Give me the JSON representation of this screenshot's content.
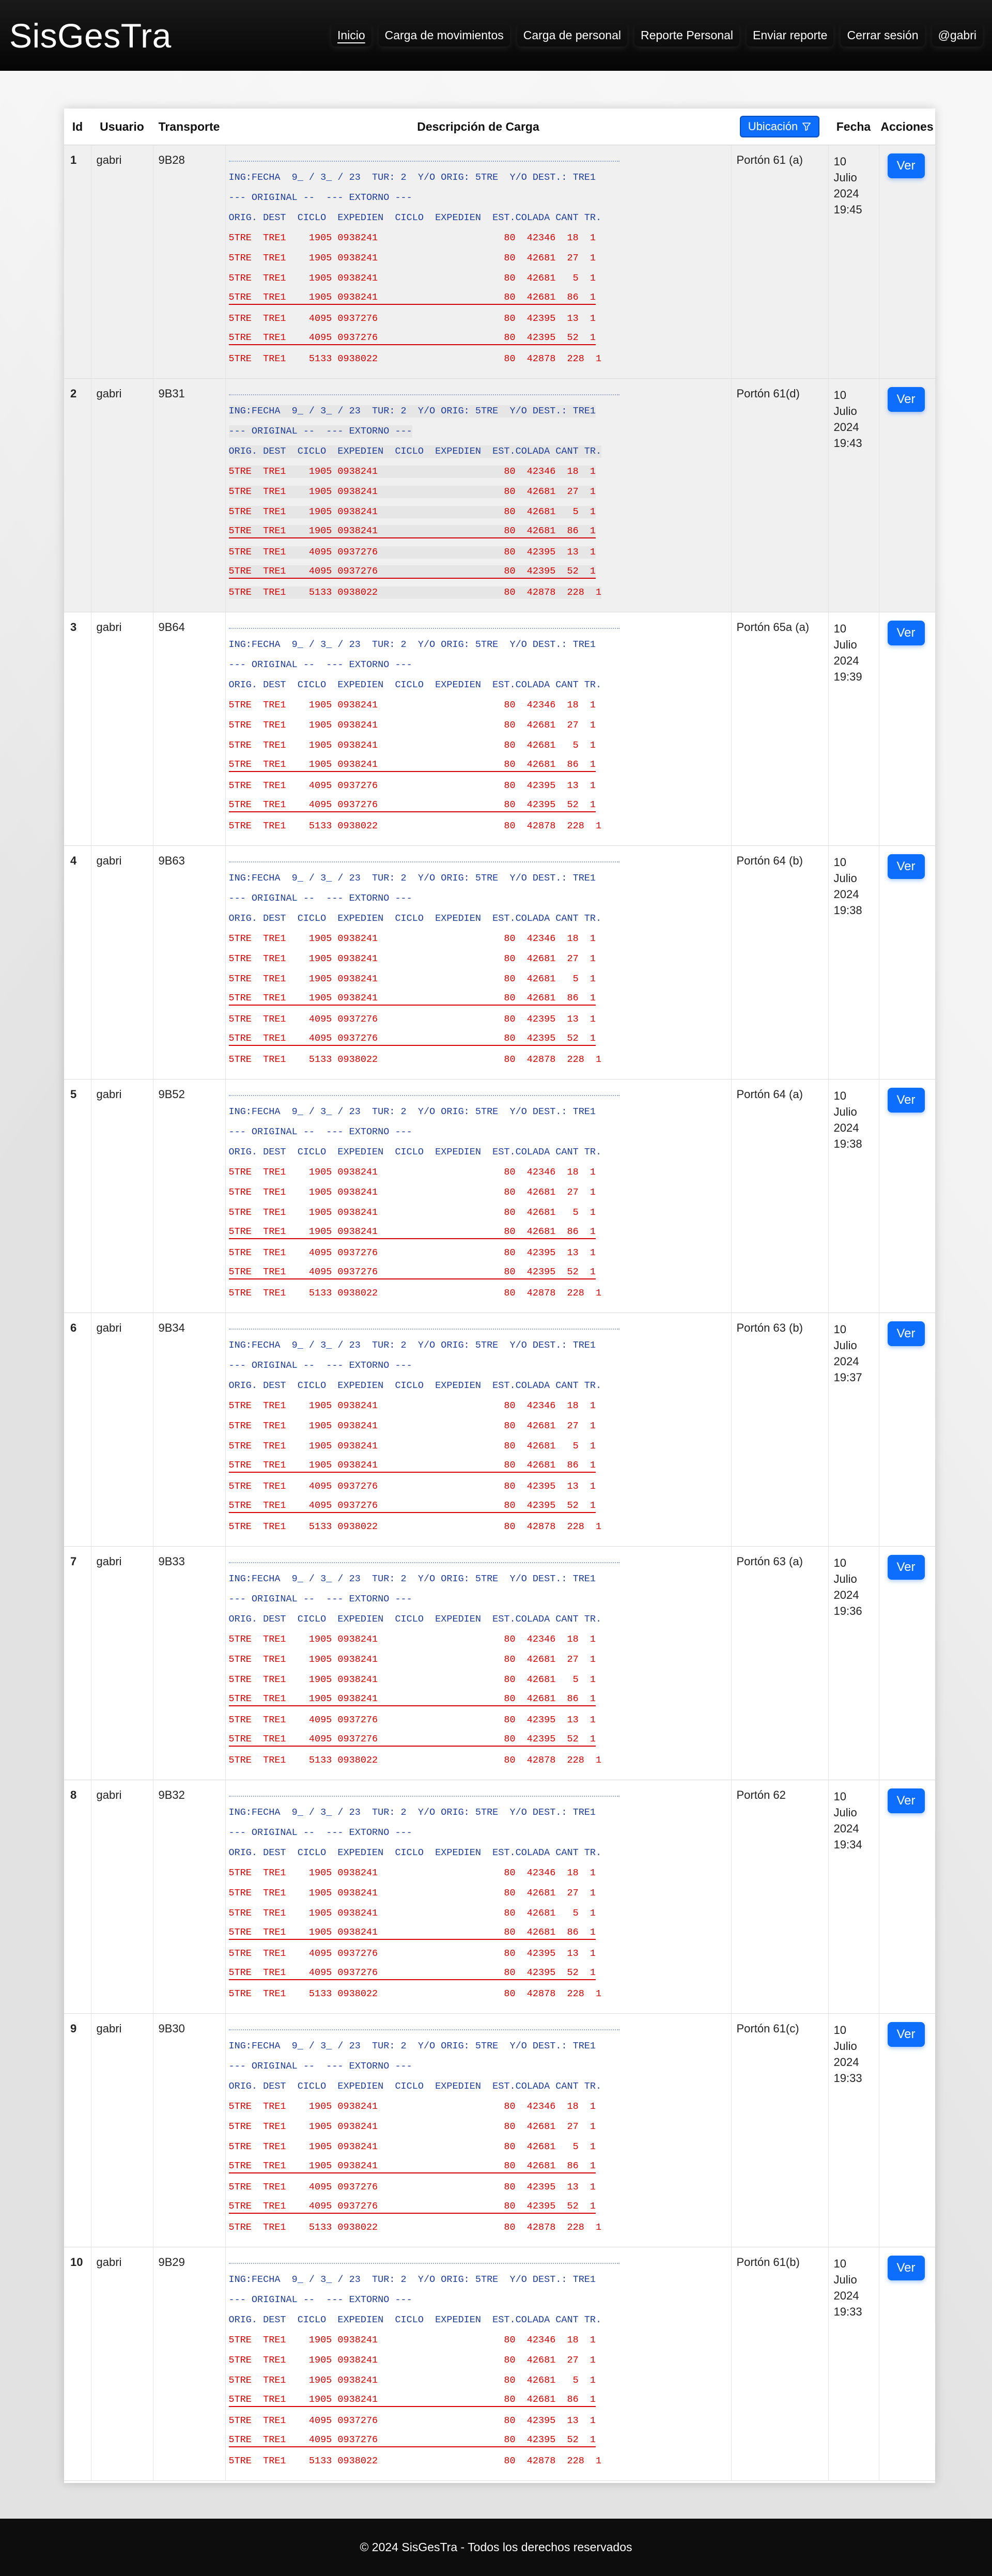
{
  "app": {
    "brand": "SisGesTra"
  },
  "nav": [
    {
      "label": "Inicio"
    },
    {
      "label": "Carga de movimientos"
    },
    {
      "label": "Carga de personal"
    },
    {
      "label": "Reporte Personal"
    },
    {
      "label": "Enviar reporte"
    },
    {
      "label": "Cerrar sesión"
    },
    {
      "label": "@gabri"
    }
  ],
  "table": {
    "headers": {
      "id": "Id",
      "usuario": "Usuario",
      "transporte": "Transporte",
      "descripcion": "Descripción de Carga",
      "ubicacion": "Ubicación",
      "fecha": "Fecha",
      "acciones": "Acciones"
    },
    "filter_icon": "filter-icon",
    "view_label": "Ver"
  },
  "cargo_lines": {
    "l1": "ING:FECHA  9_ / 3_ / 23  TUR: 2  Y/O ORIG: 5TRE  Y/O DEST.: TRE1",
    "l2": "--- ORIGINAL --  --- EXTORNO ---",
    "l3": "ORIG. DEST  CICLO  EXPEDIEN  CICLO  EXPEDIEN  EST.COLADA CANT TR.",
    "r1": "5TRE  TRE1    1905 0938241                      80  42346  18  1",
    "r2": "5TRE  TRE1    1905 0938241                      80  42681  27  1",
    "r3": "5TRE  TRE1    1905 0938241                      80  42681   5  1",
    "r4": "5TRE  TRE1    1905 0938241                      80  42681  86  1",
    "r5": "5TRE  TRE1    4095 0937276                      80  42395  13  1",
    "r6": "5TRE  TRE1    4095 0937276                      80  42395  52  1",
    "r7": "5TRE  TRE1    5133 0938022                      80  42878  228  1"
  },
  "rows": [
    {
      "id": "1",
      "usuario": "gabri",
      "transporte": "9B28",
      "ubicacion": "Portón 61 (a)",
      "dia": "10",
      "mes": "Julio",
      "anio": "2024",
      "hora": "19:45"
    },
    {
      "id": "2",
      "usuario": "gabri",
      "transporte": "9B31",
      "ubicacion": "Portón 61(d)",
      "dia": "10",
      "mes": "Julio",
      "anio": "2024",
      "hora": "19:43"
    },
    {
      "id": "3",
      "usuario": "gabri",
      "transporte": "9B64",
      "ubicacion": "Portón 65a (a)",
      "dia": "10",
      "mes": "Julio",
      "anio": "2024",
      "hora": "19:39"
    },
    {
      "id": "4",
      "usuario": "gabri",
      "transporte": "9B63",
      "ubicacion": "Portón 64 (b)",
      "dia": "10",
      "mes": "Julio",
      "anio": "2024",
      "hora": "19:38"
    },
    {
      "id": "5",
      "usuario": "gabri",
      "transporte": "9B52",
      "ubicacion": "Portón 64 (a)",
      "dia": "10",
      "mes": "Julio",
      "anio": "2024",
      "hora": "19:38"
    },
    {
      "id": "6",
      "usuario": "gabri",
      "transporte": "9B34",
      "ubicacion": "Portón 63 (b)",
      "dia": "10",
      "mes": "Julio",
      "anio": "2024",
      "hora": "19:37"
    },
    {
      "id": "7",
      "usuario": "gabri",
      "transporte": "9B33",
      "ubicacion": "Portón 63 (a)",
      "dia": "10",
      "mes": "Julio",
      "anio": "2024",
      "hora": "19:36"
    },
    {
      "id": "8",
      "usuario": "gabri",
      "transporte": "9B32",
      "ubicacion": "Portón 62",
      "dia": "10",
      "mes": "Julio",
      "anio": "2024",
      "hora": "19:34"
    },
    {
      "id": "9",
      "usuario": "gabri",
      "transporte": "9B30",
      "ubicacion": "Portón 61(c)",
      "dia": "10",
      "mes": "Julio",
      "anio": "2024",
      "hora": "19:33"
    },
    {
      "id": "10",
      "usuario": "gabri",
      "transporte": "9B29",
      "ubicacion": "Portón 61(b)",
      "dia": "10",
      "mes": "Julio",
      "anio": "2024",
      "hora": "19:33"
    }
  ],
  "footer": {
    "text": "© 2024 SisGesTra - Todos los derechos reservados"
  }
}
